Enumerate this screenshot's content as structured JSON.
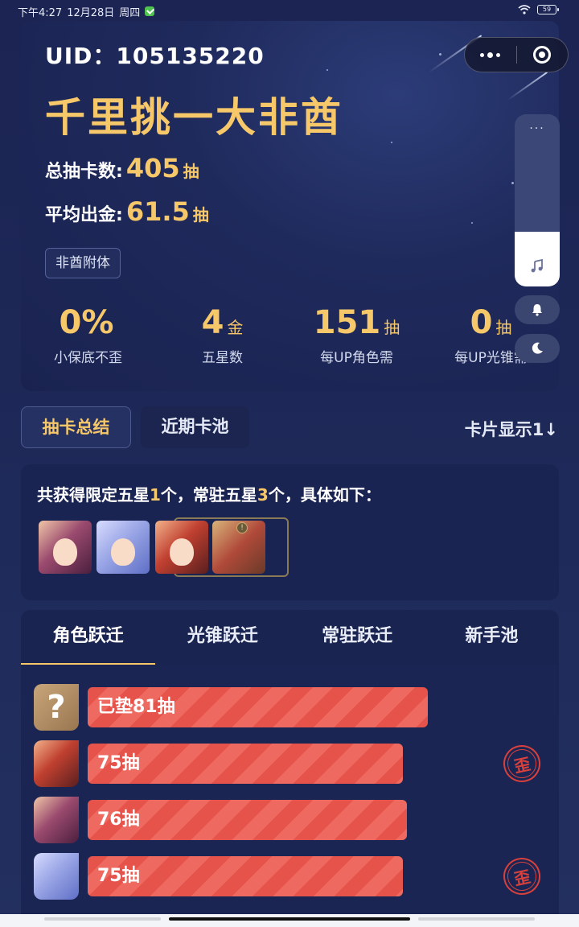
{
  "status_bar": {
    "time": "下午4:27",
    "date": "12月28日",
    "weekday": "周四",
    "battery": "59"
  },
  "header": {
    "uid": "UID：105135220",
    "title": "千里挑一大非酋",
    "total_pulls_label": "总抽卡数:",
    "total_pulls_value": "405",
    "total_pulls_unit": "抽",
    "avg_gold_label": "平均出金:",
    "avg_gold_value": "61.5",
    "avg_gold_unit": "抽",
    "tag": "非酋附体",
    "metrics": [
      {
        "value": "0%",
        "unit": "",
        "label": "小保底不歪"
      },
      {
        "value": "4",
        "unit": "金",
        "label": "五星数"
      },
      {
        "value": "151",
        "unit": "抽",
        "label": "每UP角色需"
      },
      {
        "value": "0",
        "unit": "抽",
        "label": "每UP光锥需"
      }
    ]
  },
  "side_controls": {
    "more": "···",
    "volume_level": 0.32,
    "icons": [
      "music-icon",
      "bell-icon",
      "moon-icon"
    ]
  },
  "tabs": {
    "summary": "抽卡总结",
    "recent": "近期卡池",
    "card_display": "卡片显示1↓"
  },
  "summary": {
    "prefix": "共获得限定五星",
    "limited_count": "1",
    "mid": "个，常驻五星",
    "standard_count": "3",
    "suffix": "个，具体如下：",
    "lc_badge": "!"
  },
  "pool": {
    "tabs": [
      "角色跃迁",
      "光锥跃迁",
      "常驻跃迁",
      "新手池"
    ],
    "active_tab": 0,
    "rows": [
      {
        "label": "已垫81抽",
        "pulls": 81,
        "icon": "?",
        "lost": false
      },
      {
        "label": "75抽",
        "pulls": 75,
        "lost": true
      },
      {
        "label": "76抽",
        "pulls": 76,
        "lost": false
      },
      {
        "label": "75抽",
        "pulls": 75,
        "lost": true
      }
    ],
    "lost_stamp": "歪"
  },
  "colors": {
    "accent_gold": "#f7c86a",
    "bar_red": "#e5534b",
    "background": "#1d2857"
  }
}
